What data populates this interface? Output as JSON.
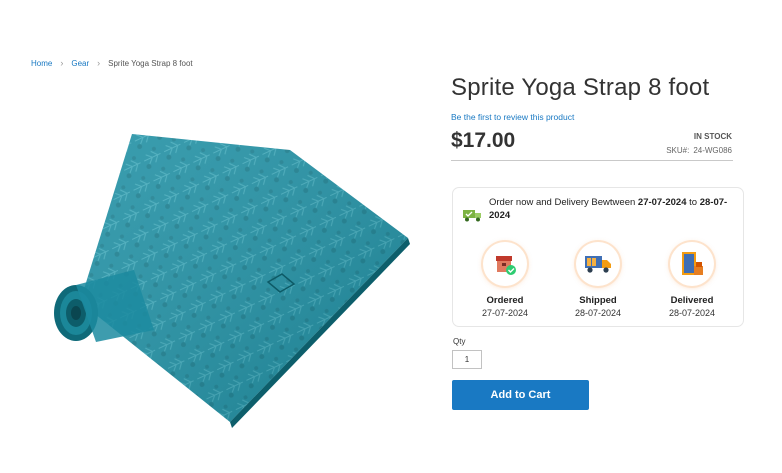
{
  "breadcrumbs": {
    "home": "Home",
    "gear": "Gear",
    "current": "Sprite Yoga Strap 8 foot",
    "separator": "›"
  },
  "product": {
    "title": "Sprite Yoga Strap 8 foot",
    "review_link": "Be the first to review this product",
    "price": "$17.00",
    "stock": "IN STOCK",
    "sku_label": "SKU#:",
    "sku_value": "24-WG086",
    "image_icon": "teal-yoga-mat-image"
  },
  "delivery": {
    "text_pre": "Order now and Delivery Bewtween ",
    "date_from": "27-07-2024",
    "text_mid": " to ",
    "date_to": "28-07-2024",
    "steps": [
      {
        "label": "Ordered",
        "date": "27-07-2024",
        "icon": "ordered-box-icon"
      },
      {
        "label": "Shipped",
        "date": "28-07-2024",
        "icon": "delivery-truck-icon"
      },
      {
        "label": "Delivered",
        "date": "28-07-2024",
        "icon": "door-delivered-icon"
      }
    ]
  },
  "cart": {
    "qty_label": "Qty",
    "qty_value": "1",
    "add_to_cart": "Add to Cart"
  },
  "colors": {
    "link": "#1979c3",
    "button": "#1979c3",
    "accent_orange": "#f08c3c",
    "mat_teal": "#1e8fa3"
  }
}
